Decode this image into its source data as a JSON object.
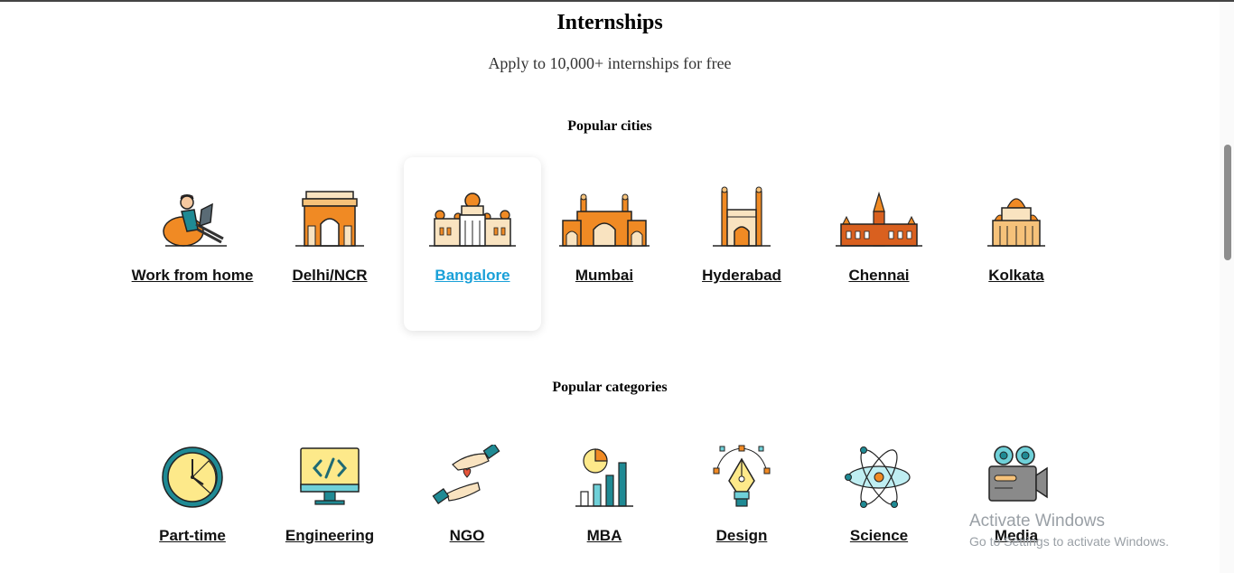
{
  "header": {
    "title": "Internships",
    "subtitle": "Apply to 10,000+ internships for free"
  },
  "cities": {
    "title": "Popular cities",
    "items": [
      {
        "label": "Work from home",
        "icon": "person-laptop-icon"
      },
      {
        "label": "Delhi/NCR",
        "icon": "india-gate-icon"
      },
      {
        "label": "Bangalore",
        "icon": "vidhana-soudha-icon",
        "selected": true
      },
      {
        "label": "Mumbai",
        "icon": "gateway-of-india-icon"
      },
      {
        "label": "Hyderabad",
        "icon": "charminar-icon"
      },
      {
        "label": "Chennai",
        "icon": "chennai-central-icon"
      },
      {
        "label": "Kolkata",
        "icon": "kolkata-temple-icon"
      }
    ]
  },
  "categories": {
    "title": "Popular categories",
    "items": [
      {
        "label": "Part-time",
        "icon": "clock-icon"
      },
      {
        "label": "Engineering",
        "icon": "code-monitor-icon"
      },
      {
        "label": "NGO",
        "icon": "helping-hands-icon"
      },
      {
        "label": "MBA",
        "icon": "bar-chart-icon"
      },
      {
        "label": "Design",
        "icon": "pen-nib-icon"
      },
      {
        "label": "Science",
        "icon": "atom-icon"
      },
      {
        "label": "Media",
        "icon": "video-camera-icon"
      }
    ]
  },
  "watermark": {
    "title": "Activate Windows",
    "subtitle": "Go to Settings to activate Windows."
  },
  "colors": {
    "accent": "#1aa0d8",
    "orange": "#f08a24",
    "light_orange": "#f6c27a",
    "cream": "#f9e3c0",
    "teal": "#1f8a94",
    "light_teal": "#6fd0d8",
    "yellow": "#fde98a"
  }
}
